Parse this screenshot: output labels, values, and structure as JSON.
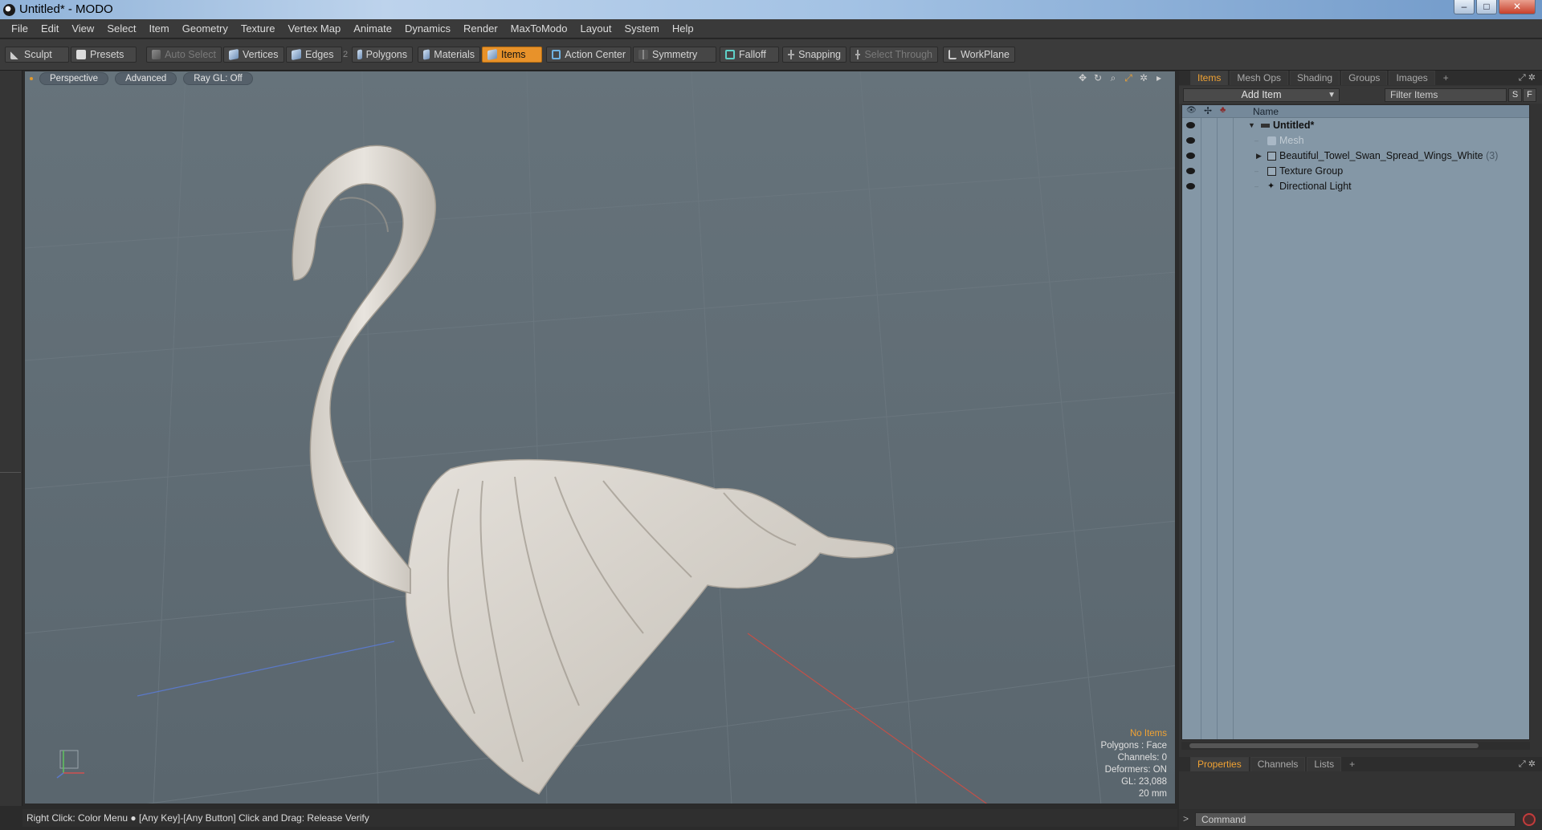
{
  "window": {
    "title": "Untitled* - MODO",
    "minimize": "–",
    "maximize": "□",
    "close": "✕"
  },
  "menu": [
    "File",
    "Edit",
    "View",
    "Select",
    "Item",
    "Geometry",
    "Texture",
    "Vertex Map",
    "Animate",
    "Dynamics",
    "Render",
    "MaxToModo",
    "Layout",
    "System",
    "Help"
  ],
  "toolbar": {
    "sculpt": "Sculpt",
    "presets": "Presets",
    "auto_select": "Auto Select",
    "vertices": "Vertices",
    "edges": "Edges",
    "edges_count": "2",
    "polygons": "Polygons",
    "materials": "Materials",
    "items": "Items",
    "action_center": "Action Center",
    "symmetry": "Symmetry",
    "falloff": "Falloff",
    "snapping": "Snapping",
    "select_through": "Select Through",
    "workplane": "WorkPlane"
  },
  "viewport": {
    "tabs": [
      "Perspective",
      "Advanced",
      "Ray GL: Off"
    ],
    "info": {
      "no_items": "No Items",
      "polygons": "Polygons : Face",
      "channels": "Channels: 0",
      "deformers": "Deformers: ON",
      "gl": "GL: 23,088",
      "scale": "20 mm"
    }
  },
  "status": "Right Click: Color Menu ● [Any Key]-[Any Button] Click and Drag: Release Verify",
  "panel": {
    "tabs": [
      "Items",
      "Mesh Ops",
      "Shading",
      "Groups",
      "Images",
      "+"
    ],
    "add_item": "Add Item",
    "filter_placeholder": "Filter Items",
    "s_btn": "S",
    "f_btn": "F",
    "name_header": "Name",
    "tree": [
      {
        "label": "Untitled*",
        "count": ""
      },
      {
        "label": "Mesh",
        "count": ""
      },
      {
        "label": "Beautiful_Towel_Swan_Spread_Wings_White",
        "count": "(3)"
      },
      {
        "label": "Texture Group",
        "count": ""
      },
      {
        "label": "Directional Light",
        "count": ""
      }
    ],
    "props_tabs": [
      "Properties",
      "Channels",
      "Lists",
      "+"
    ],
    "command_placeholder": "Command",
    "command_prompt": ">"
  },
  "colors": {
    "accent": "#f0a233",
    "viewport_bg": "#5e6a72",
    "tree_bg": "#8497a6"
  }
}
